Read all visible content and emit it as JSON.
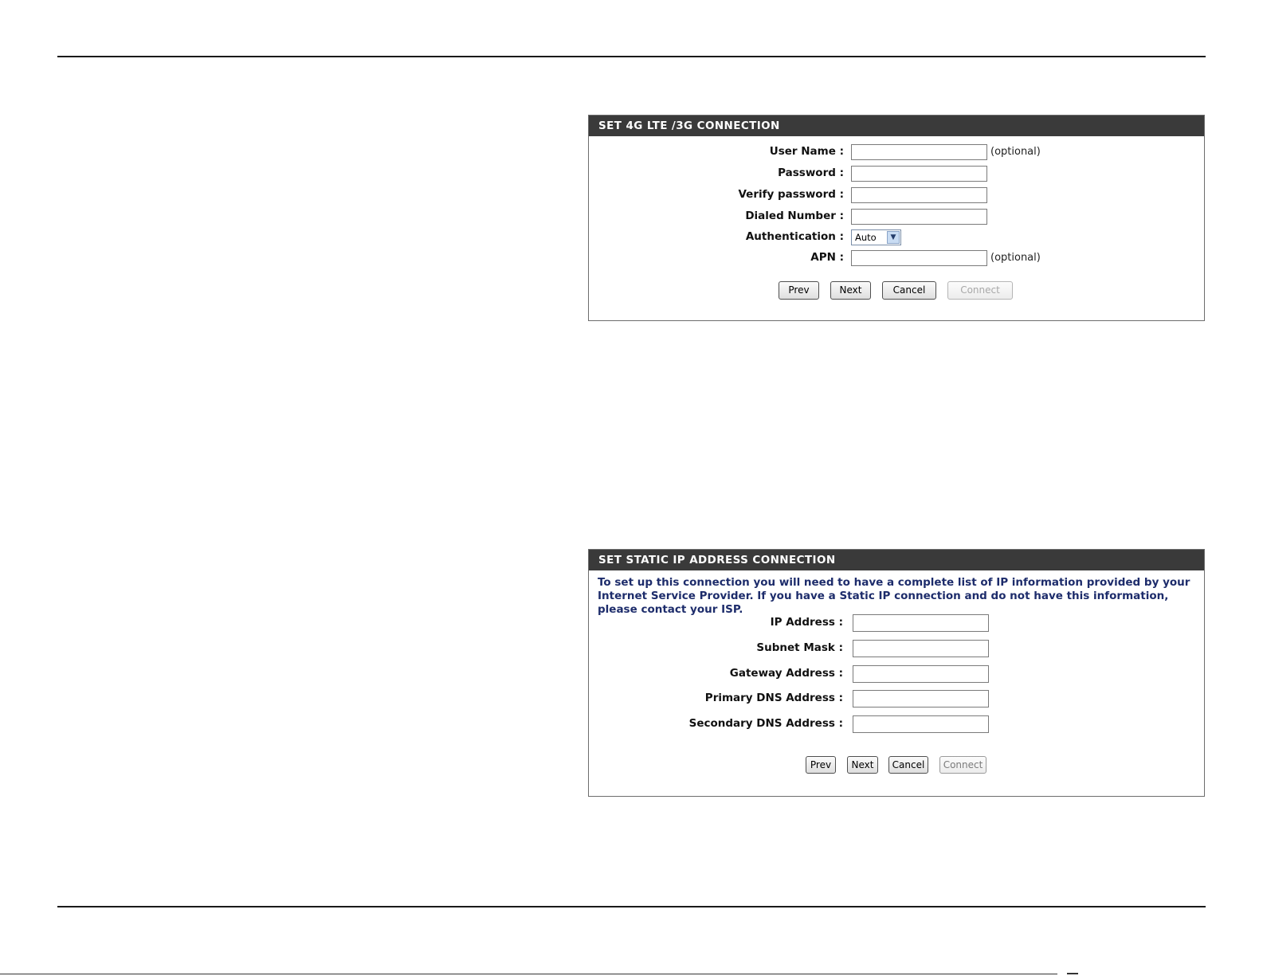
{
  "lte_panel": {
    "title": "SET 4G LTE /3G CONNECTION",
    "user_name_label": "User Name :",
    "user_name_value": "",
    "user_name_hint": "(optional)",
    "password_label": "Password :",
    "password_value": "",
    "verify_password_label": "Verify password :",
    "verify_password_value": "",
    "dialed_number_label": "Dialed Number :",
    "dialed_number_value": "",
    "authentication_label": "Authentication :",
    "authentication_value": "Auto",
    "apn_label": "APN :",
    "apn_value": "",
    "apn_hint": "(optional)",
    "buttons": {
      "prev": "Prev",
      "next": "Next",
      "cancel": "Cancel",
      "connect": "Connect"
    }
  },
  "static_panel": {
    "title": "SET STATIC IP ADDRESS CONNECTION",
    "intro": "To set up this connection you will need to have a complete list of IP information provided by your Internet Service Provider. If you have a Static IP connection and do not have this information, please contact your ISP.",
    "ip_address_label": "IP Address :",
    "ip_address_value": "",
    "subnet_mask_label": "Subnet Mask :",
    "subnet_mask_value": "",
    "gateway_label": "Gateway Address :",
    "gateway_value": "",
    "primary_dns_label": "Primary DNS Address :",
    "primary_dns_value": "",
    "secondary_dns_label": "Secondary DNS Address :",
    "secondary_dns_value": "",
    "buttons": {
      "prev": "Prev",
      "next": "Next",
      "cancel": "Cancel",
      "connect": "Connect"
    }
  },
  "colors": {
    "header_bg": "#3a3a3a",
    "header_text": "#ffffff",
    "intro_text": "#1d2c6b"
  },
  "icons": {
    "authentication_dropdown": "chevron-down-icon"
  }
}
